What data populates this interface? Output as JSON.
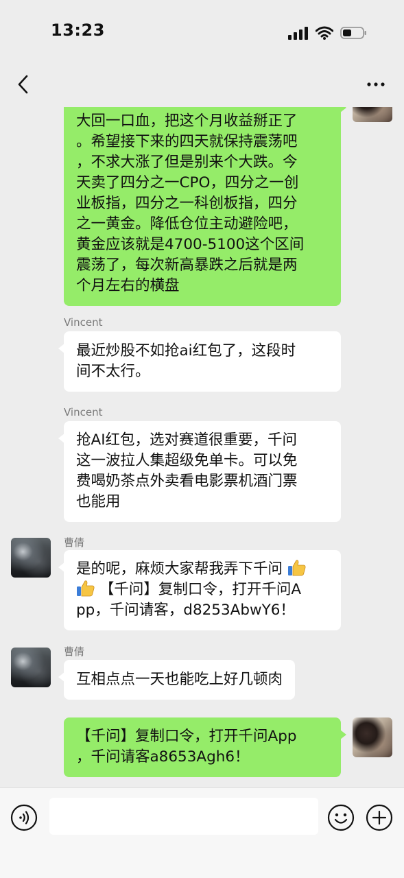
{
  "status_bar": {
    "time": "13:23"
  },
  "nav": {
    "title": ""
  },
  "messages": [
    {
      "side": "right",
      "lines": [
        "大回一口血，把这个月收益掰正了",
        "。希望接下来的四天就保持震荡吧",
        "，不求大涨了但是别来个大跌。今",
        "天卖了四分之一CPO，四分之一创",
        "业板指，四分之一科创板指，四分",
        "之一黄金。降低仓位主动避险吧，",
        "黄金应该就是4700-5100这个区间",
        "震荡了，每次新高暴跌之后就是两",
        "个月左右的横盘"
      ]
    },
    {
      "side": "left",
      "sender": "Vincent",
      "lines": [
        "最近炒股不如抢ai红包了，这段时",
        "间不太行。"
      ]
    },
    {
      "side": "left",
      "sender": "Vincent",
      "lines": [
        "抢AI红包，选对赛道很重要，千问",
        "这一波拉人集超级免单卡。可以免",
        "费喝奶茶点外卖看电影票机酒门票",
        "也能用"
      ]
    },
    {
      "side": "left",
      "sender": "曹倩",
      "lines": [
        "是的呢，麻烦大家帮我弄下千问",
        "【千问】复制口令，打开千问A",
        "pp，千问请客，d8253AbwY6！"
      ],
      "emoji": "thumbs-up"
    },
    {
      "side": "left",
      "sender": "曹倩",
      "lines": [
        "互相点点一天也能吃上好几顿肉"
      ]
    },
    {
      "side": "right",
      "lines": [
        "【千问】复制口令，打开千问App",
        "，千问请客a8653Agh6！"
      ]
    }
  ],
  "input": {
    "placeholder": ""
  },
  "icons": [
    "signal-icon",
    "wifi-icon",
    "battery-icon",
    "back-icon",
    "more-icon",
    "voice-icon",
    "emoji-icon",
    "plus-icon",
    "thumbs-up-icon"
  ],
  "colors": {
    "bubble_me": "#95ec69",
    "bubble_other": "#ffffff",
    "background": "#ededed"
  }
}
